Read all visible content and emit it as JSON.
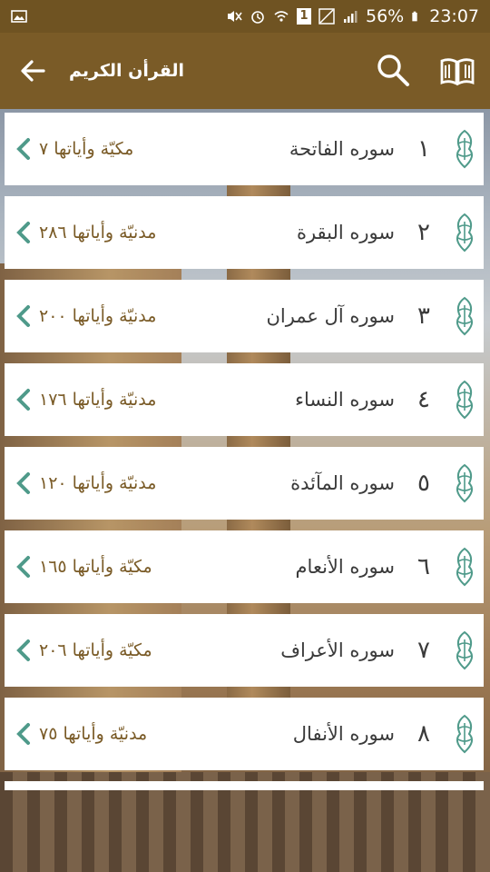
{
  "status_bar": {
    "battery_percent": "56%",
    "time": "23:07",
    "sim_label": "1"
  },
  "header": {
    "title": "القرأن الكريم",
    "icons": [
      "back-arrow-icon",
      "search-icon",
      "book-icon"
    ]
  },
  "colors": {
    "app_bar": "#7a5b27",
    "accent_green": "#4f9a8a",
    "info_text": "#7a5b27"
  },
  "surahs": [
    {
      "number": "١",
      "name": "سوره الفاتحة",
      "info": "مكيّة وأياتها ٧"
    },
    {
      "number": "٢",
      "name": "سوره البقرة",
      "info": "مدنيّة وأياتها ٢٨٦"
    },
    {
      "number": "٣",
      "name": "سوره آل عمران",
      "info": "مدنيّة وأياتها ٢٠٠"
    },
    {
      "number": "٤",
      "name": "سوره النساء",
      "info": "مدنيّة وأياتها ١٧٦"
    },
    {
      "number": "٥",
      "name": "سوره المآئدة",
      "info": "مدنيّة وأياتها ١٢٠"
    },
    {
      "number": "٦",
      "name": "سوره الأنعام",
      "info": "مكيّة وأياتها ١٦٥"
    },
    {
      "number": "٧",
      "name": "سوره الأعراف",
      "info": "مكيّة وأياتها ٢٠٦"
    },
    {
      "number": "٨",
      "name": "سوره الأنفال",
      "info": "مدنيّة وأياتها ٧٥"
    }
  ]
}
